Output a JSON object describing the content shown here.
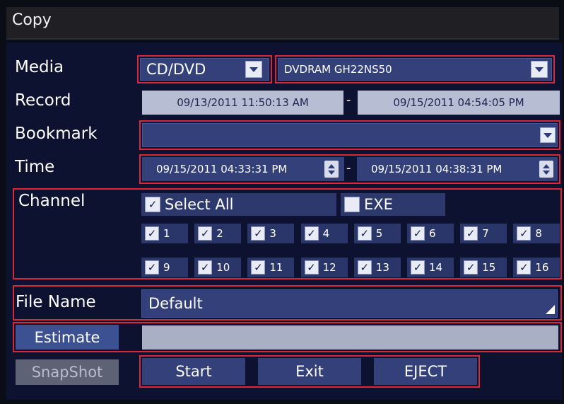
{
  "window": {
    "title": "Copy"
  },
  "media": {
    "label": "Media",
    "type_value": "CD/DVD",
    "device_value": "DVDRAM GH22NS50"
  },
  "record": {
    "label": "Record",
    "start": "09/13/2011 11:50:13 AM",
    "separator": "-",
    "end": "09/15/2011 04:54:05 PM"
  },
  "bookmark": {
    "label": "Bookmark",
    "value": ""
  },
  "time": {
    "label": "Time",
    "start": "09/15/2011 04:33:31 PM",
    "separator": "-",
    "end": "09/15/2011 04:38:31 PM"
  },
  "channel": {
    "label": "Channel",
    "select_all_label": "Select All",
    "select_all_checked": true,
    "exe_label": "EXE",
    "exe_checked": false,
    "channels": [
      "1",
      "2",
      "3",
      "4",
      "5",
      "6",
      "7",
      "8",
      "9",
      "10",
      "11",
      "12",
      "13",
      "14",
      "15",
      "16"
    ],
    "check_mark": "✓"
  },
  "file_name": {
    "label": "File Name",
    "value": "Default"
  },
  "estimate": {
    "button_label": "Estimate",
    "result": ""
  },
  "buttons": {
    "snapshot": "SnapShot",
    "start": "Start",
    "exit": "Exit",
    "eject": "EJECT"
  },
  "colors": {
    "accent_red": "#d9283a",
    "field_blue": "#34407a",
    "panel_bg": "#0c1230"
  }
}
